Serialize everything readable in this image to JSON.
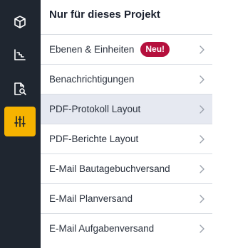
{
  "rail": {
    "items": [
      {
        "icon": "cube-icon",
        "active": false
      },
      {
        "icon": "stairs-chart-icon",
        "active": false
      },
      {
        "icon": "document-search-icon",
        "active": false
      },
      {
        "icon": "sliders-icon",
        "active": true
      }
    ],
    "colors": {
      "background": "#1f2630",
      "active": "#f6b300"
    }
  },
  "panel": {
    "title": "Nur für dieses Projekt",
    "items": [
      {
        "label": "Ebenen & Einheiten",
        "badge": "Neu!"
      },
      {
        "label": "Benachrichtigungen"
      },
      {
        "label": "PDF-Protokoll Layout",
        "selected": true
      },
      {
        "label": "PDF-Berichte Layout"
      },
      {
        "label": "E-Mail Bautagebuchversand"
      },
      {
        "label": "E-Mail Planversand"
      },
      {
        "label": "E-Mail Aufgabenversand"
      }
    ],
    "colors": {
      "badge": "#b5103d",
      "selected_row": "#e6e9f1"
    }
  }
}
